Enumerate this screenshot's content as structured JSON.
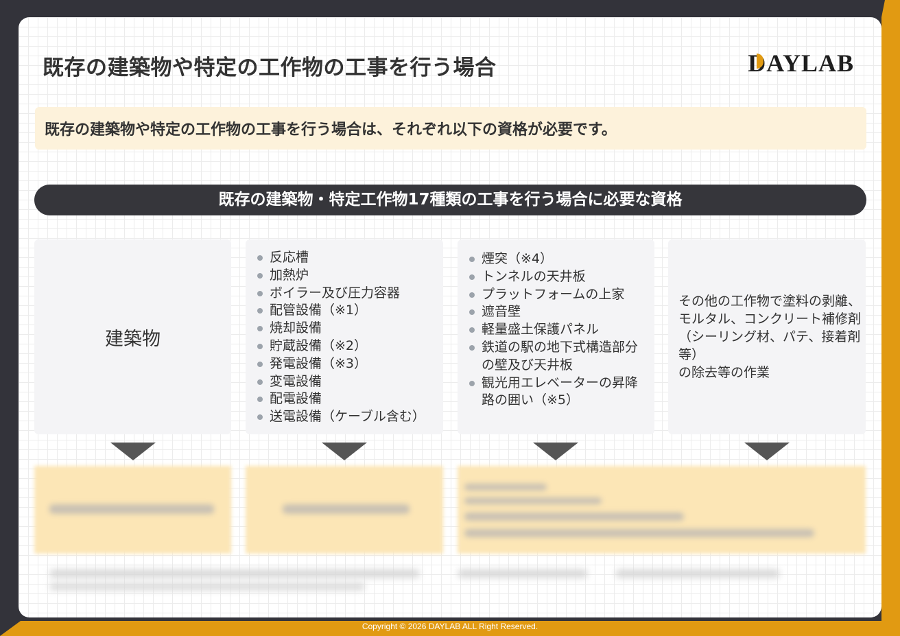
{
  "header": {
    "title": "既存の建築物や特定の工作物の工事を行う場合",
    "logo_text": "DAYLAB"
  },
  "lead": "既存の建築物や特定の工作物の工事を行う場合は、それぞれ以下の資格が必要です。",
  "banner": "既存の建築物・特定工作物17種類の工事を行う場合に必要な資格",
  "columns": {
    "buildings": "建築物",
    "equipment": [
      "反応槽",
      "加熱炉",
      "ボイラー及び圧力容器",
      "配管設備（※1）",
      "焼却設備",
      "貯蔵設備（※2）",
      "発電設備（※3）",
      "変電設備",
      "配電設備",
      "送電設備（ケーブル含む）"
    ],
    "structures": [
      "煙突（※4）",
      "トンネルの天井板",
      "プラットフォームの上家",
      "遮音壁",
      "軽量盛土保護パネル",
      "鉄道の駅の地下式構造部分の壁及び天井板",
      "観光用エレベーターの昇降路の囲い（※5）"
    ],
    "other": "その他の工作物で塗料の剥離、\nモルタル、コンクリート補修剤\n（シーリング材、パテ、接着剤等）\nの除去等の作業"
  },
  "colors": {
    "accent": "#e19a12",
    "dark": "#36363b",
    "lead_bg": "#fdf2db"
  },
  "footer": "Copyright © 2026 DAYLAB ALL Right Reserved."
}
